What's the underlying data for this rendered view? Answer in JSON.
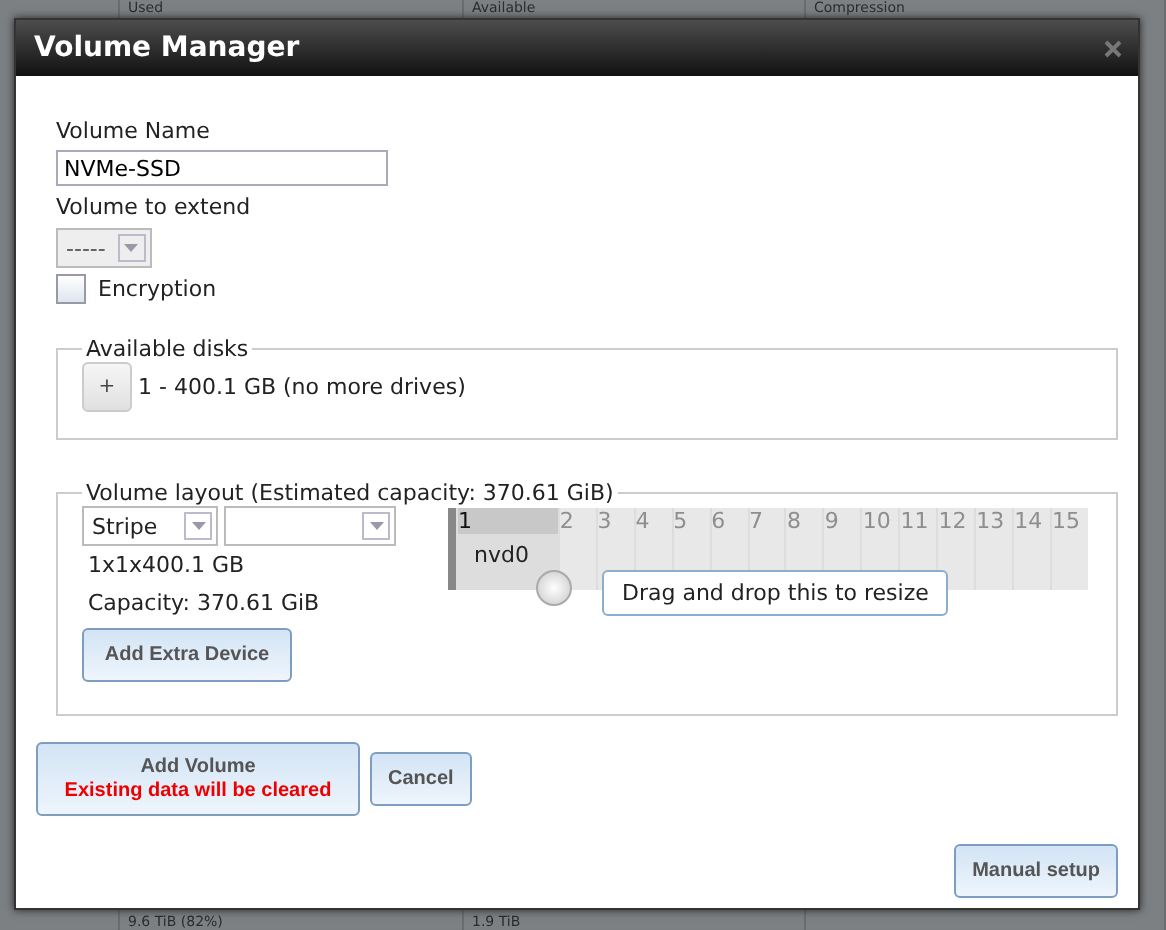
{
  "background_table": {
    "columns": [
      "Used",
      "Available",
      "Compression"
    ],
    "last_row": [
      "9.6 TiB (82%)",
      "1.9 TiB"
    ]
  },
  "dialog": {
    "title": "Volume Manager",
    "volume_name": {
      "label": "Volume Name",
      "value": "NVMe-SSD"
    },
    "volume_to_extend": {
      "label": "Volume to extend",
      "value": "-----",
      "disabled": true
    },
    "encryption": {
      "label": "Encryption",
      "checked": false
    },
    "available_disks": {
      "legend": "Available disks",
      "add_button": "+",
      "description": "1 - 400.1 GB (no more drives)"
    },
    "volume_layout": {
      "legend": "Volume layout (Estimated capacity: 370.61 GiB)",
      "layout_type": "Stripe",
      "summary": "1x1x400.1 GB",
      "capacity": "Capacity: 370.61 GiB",
      "add_extra_device": "Add Extra Device",
      "columns": [
        {
          "label": "1",
          "selected": true
        },
        {
          "label": "2",
          "selected": false
        },
        {
          "label": "3",
          "selected": false
        },
        {
          "label": "4",
          "selected": false
        },
        {
          "label": "5",
          "selected": false
        },
        {
          "label": "6",
          "selected": false
        },
        {
          "label": "7",
          "selected": false
        },
        {
          "label": "8",
          "selected": false
        },
        {
          "label": "9",
          "selected": false
        },
        {
          "label": "10",
          "selected": false
        },
        {
          "label": "11",
          "selected": false
        },
        {
          "label": "12",
          "selected": false
        },
        {
          "label": "13",
          "selected": false
        },
        {
          "label": "14",
          "selected": false
        },
        {
          "label": "15",
          "selected": false
        }
      ],
      "device": "nvd0",
      "tooltip": "Drag and drop this to resize"
    },
    "add_volume": {
      "label": "Add Volume",
      "warning": "Existing data will be cleared"
    },
    "cancel": "Cancel",
    "manual_setup": "Manual setup"
  }
}
